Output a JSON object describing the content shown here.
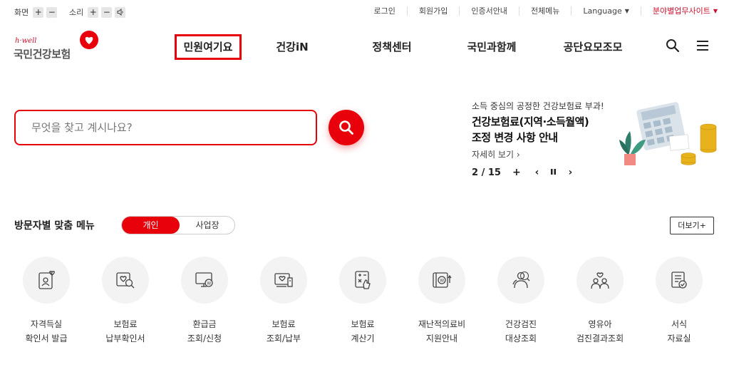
{
  "utility": {
    "screen_label": "화면",
    "sound_label": "소리",
    "plus": "+",
    "minus": "−",
    "links": [
      "로그인",
      "회원가입",
      "인증서안내",
      "전체메뉴",
      "Language",
      "분야별업무사이트"
    ]
  },
  "logo": {
    "tagline": "h·well",
    "name": "국민건강보험"
  },
  "nav": {
    "items": [
      "민원여기요",
      "건강iN",
      "정책센터",
      "국민과함께",
      "공단요모조모"
    ],
    "active_index": 0
  },
  "search": {
    "placeholder": "무엇을 찾고 계시나요?"
  },
  "banner": {
    "subtitle": "소득 중심의 공정한 건강보험료 부과!",
    "title_line1": "건강보험료(지역·소득월액)",
    "title_line2": "조정 변경 사항 안내",
    "more": "자세히 보기 ›",
    "pager": "2 / 15",
    "plus": "+",
    "prev": "‹",
    "next": "›"
  },
  "section": {
    "title": "방문자별 맞춤 메뉴",
    "toggle": [
      "개인",
      "사업장"
    ],
    "more_button": "더보기+"
  },
  "quick_menu": [
    {
      "icon": "certificate-person-icon",
      "line1": "자격득실",
      "line2": "확인서 발급"
    },
    {
      "icon": "insurance-search-icon",
      "line1": "보험료",
      "line2": "납부확인서"
    },
    {
      "icon": "refund-monitor-icon",
      "line1": "환급금",
      "line2": "조회/신청"
    },
    {
      "icon": "payment-doc-icon",
      "line1": "보험료",
      "line2": "조회/납부"
    },
    {
      "icon": "calculator-hand-icon",
      "line1": "보험료",
      "line2": "계산기"
    },
    {
      "icon": "medical-aid-icon",
      "line1": "재난적의료비",
      "line2": "지원안내"
    },
    {
      "icon": "checkup-person-icon",
      "line1": "건강검진",
      "line2": "대상조회"
    },
    {
      "icon": "infant-checkup-icon",
      "line1": "영유아",
      "line2": "검진결과조회"
    },
    {
      "icon": "document-check-icon",
      "line1": "서식",
      "line2": "자료실"
    }
  ],
  "colors": {
    "accent": "#e8000b",
    "brand_red": "#c8102e"
  }
}
